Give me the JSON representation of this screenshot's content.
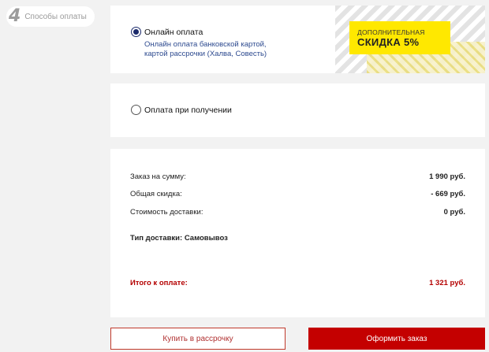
{
  "step": {
    "number": "4",
    "label": "Способы оплаты"
  },
  "online": {
    "title": "Онлайн оплата",
    "desc_line1": "Онлайн оплата банковской картой,",
    "desc_line2": "картой рассрочки (Халва, Совесть)",
    "checked": true
  },
  "promo": {
    "line1": "ДОПОЛНИТЕЛЬНАЯ",
    "line2": "СКИДКА 5%",
    "color": "#ffe800"
  },
  "cod": {
    "title": "Оплата при получении",
    "checked": false
  },
  "summary": {
    "order_sum_label": "Заказ на сумму:",
    "order_sum_value": "1 990 руб.",
    "discount_label": "Общая скидка:",
    "discount_value": "- 669 руб.",
    "delivery_cost_label": "Стоимость доставки:",
    "delivery_cost_value": "0 руб.",
    "delivery_type": "Тип доставки: Самовывоз",
    "total_label": "Итого к оплате:",
    "total_value": "1 321 руб.",
    "total_color": "#b40000"
  },
  "buttons": {
    "installment_label": "Купить в рассрочку",
    "order_label": "Оформить заказ",
    "order_color": "#c40000"
  }
}
